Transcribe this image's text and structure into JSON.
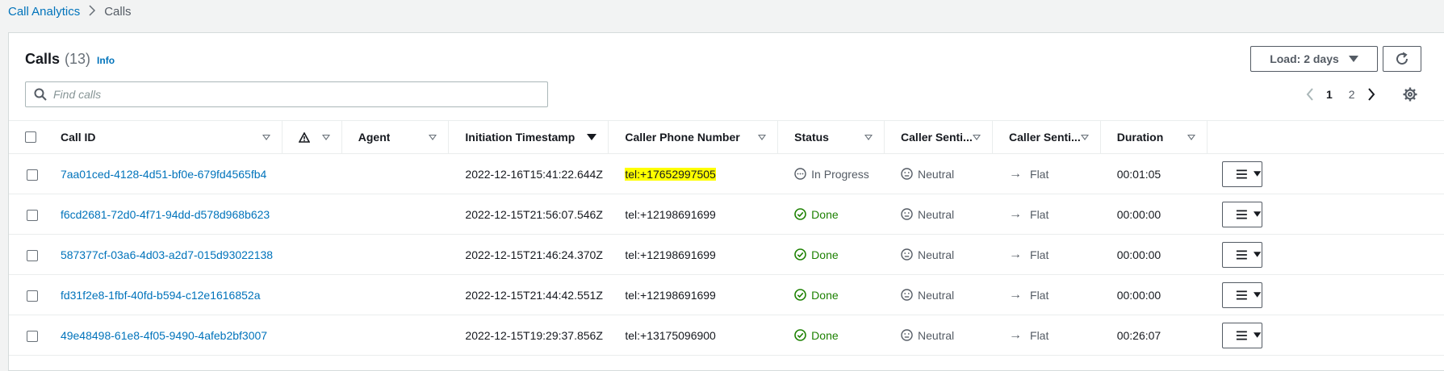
{
  "breadcrumb": {
    "root": "Call Analytics",
    "separator": ">",
    "current": "Calls"
  },
  "header": {
    "title": "Calls",
    "count": "(13)",
    "info": "Info"
  },
  "toolbar": {
    "load_label": "Load: 2 days",
    "refresh_icon": "refresh-icon"
  },
  "search": {
    "placeholder": "Find calls",
    "value": ""
  },
  "pagination": {
    "pages": [
      "1",
      "2"
    ],
    "current": "1"
  },
  "columns": {
    "call_id": "Call ID",
    "alert": "",
    "agent": "Agent",
    "initiation": "Initiation Timestamp",
    "caller_phone": "Caller Phone Number",
    "status": "Status",
    "caller_senti_1": "Caller Senti...",
    "caller_senti_2": "Caller Senti...",
    "duration": "Duration"
  },
  "colors": {
    "link": "#0073bb",
    "done": "#1d8102",
    "highlight": "#ffff00"
  },
  "rows": [
    {
      "call_id": "7aa01ced-4128-4d51-bf0e-679fd4565fb4",
      "agent": "",
      "initiation": "2022-12-16T15:41:22.644Z",
      "caller_phone": "tel:+17652997505",
      "highlighted": true,
      "status": "In Progress",
      "status_type": "progress",
      "sentiment": "Neutral",
      "trend": "Flat",
      "duration": "00:01:05"
    },
    {
      "call_id": "f6cd2681-72d0-4f71-94dd-d578d968b623",
      "agent": "",
      "initiation": "2022-12-15T21:56:07.546Z",
      "caller_phone": "tel:+12198691699",
      "highlighted": false,
      "status": "Done",
      "status_type": "done",
      "sentiment": "Neutral",
      "trend": "Flat",
      "duration": "00:00:00"
    },
    {
      "call_id": "587377cf-03a6-4d03-a2d7-015d93022138",
      "agent": "",
      "initiation": "2022-12-15T21:46:24.370Z",
      "caller_phone": "tel:+12198691699",
      "highlighted": false,
      "status": "Done",
      "status_type": "done",
      "sentiment": "Neutral",
      "trend": "Flat",
      "duration": "00:00:00"
    },
    {
      "call_id": "fd31f2e8-1fbf-40fd-b594-c12e1616852a",
      "agent": "",
      "initiation": "2022-12-15T21:44:42.551Z",
      "caller_phone": "tel:+12198691699",
      "highlighted": false,
      "status": "Done",
      "status_type": "done",
      "sentiment": "Neutral",
      "trend": "Flat",
      "duration": "00:00:00"
    },
    {
      "call_id": "49e48498-61e8-4f05-9490-4afeb2bf3007",
      "agent": "",
      "initiation": "2022-12-15T19:29:37.856Z",
      "caller_phone": "tel:+13175096900",
      "highlighted": false,
      "status": "Done",
      "status_type": "done",
      "sentiment": "Neutral",
      "trend": "Flat",
      "duration": "00:26:07"
    }
  ]
}
